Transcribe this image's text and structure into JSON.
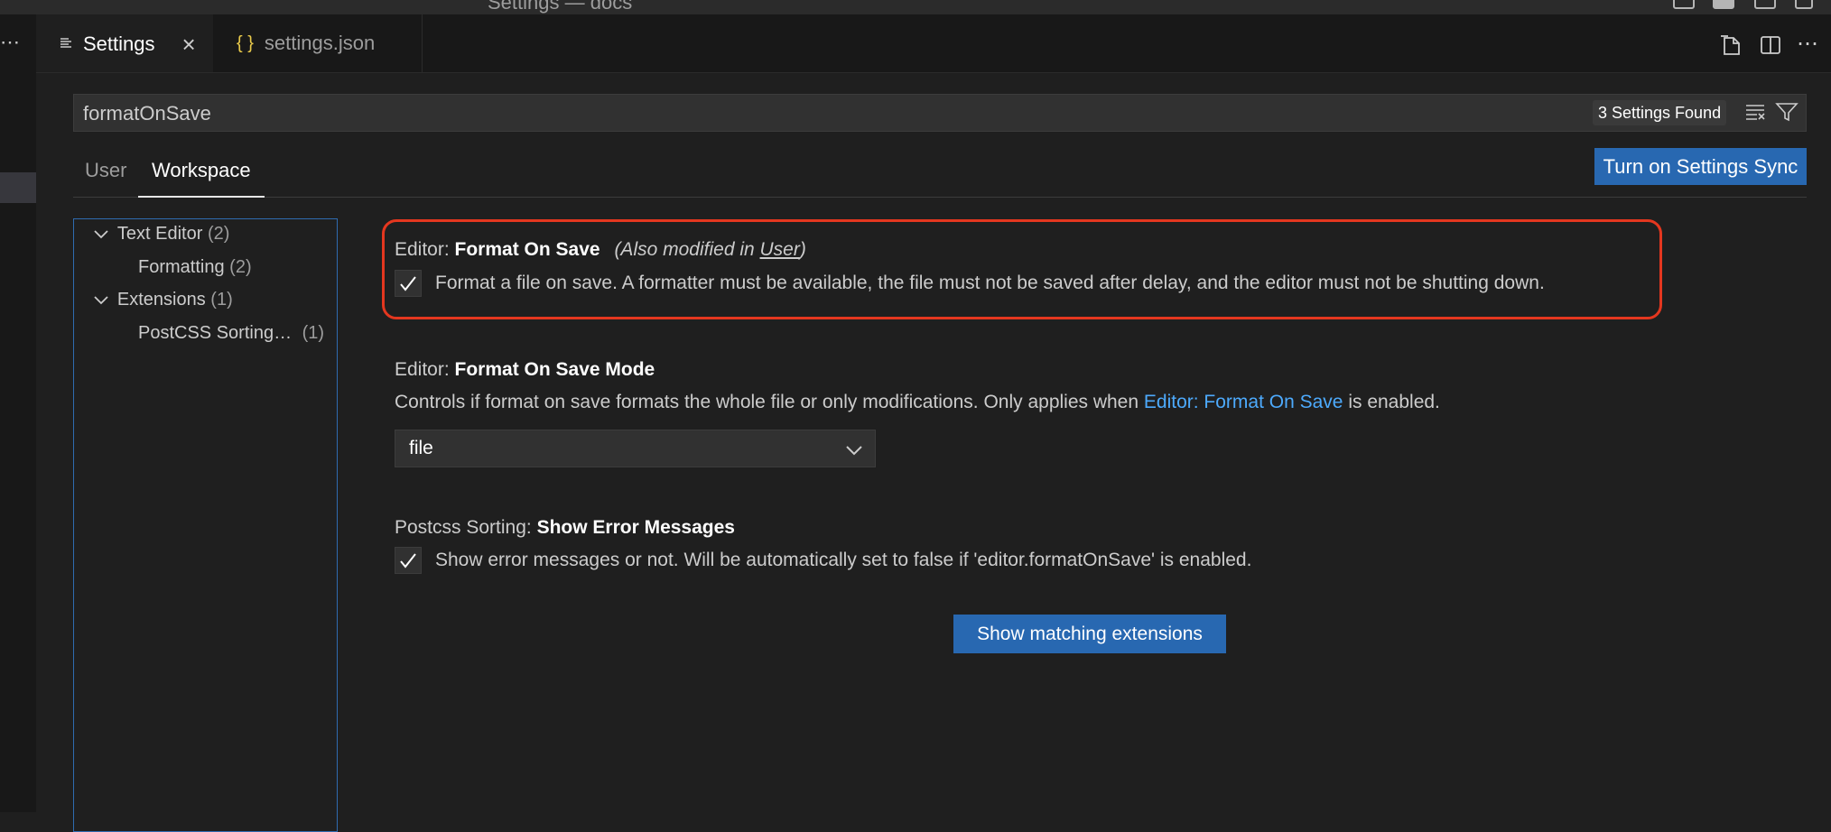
{
  "window": {
    "title": "Settings — docs"
  },
  "tabs": [
    {
      "label": "Settings",
      "icon": "settings-lines-icon"
    },
    {
      "label": "settings.json",
      "icon": "braces-icon",
      "icon_text": "{ }"
    }
  ],
  "search": {
    "value": "formatOnSave",
    "placeholder": "Search settings",
    "results": "3 Settings Found"
  },
  "scope_tabs": {
    "user": "User",
    "workspace": "Workspace",
    "active": "Workspace"
  },
  "sync_button": "Turn on Settings Sync",
  "toc": [
    {
      "label": "Text Editor",
      "count": "(2)"
    },
    {
      "label": "Formatting",
      "count": "(2)"
    },
    {
      "label": "Extensions",
      "count": "(1)"
    },
    {
      "label": "PostCSS Sorting…",
      "count": "(1)"
    }
  ],
  "settings": {
    "format_on_save": {
      "category": "Editor: ",
      "name": "Format On Save",
      "modified_prefix": "(Also modified in ",
      "modified_link": "User",
      "modified_suffix": ")",
      "checked": true,
      "description": "Format a file on save. A formatter must be available, the file must not be saved after delay, and the editor must not be shutting down."
    },
    "format_on_save_mode": {
      "category": "Editor: ",
      "name": "Format On Save Mode",
      "description_before": "Controls if format on save formats the whole file or only modifications. Only applies when ",
      "description_link": "Editor: Format On Save",
      "description_after": " is enabled.",
      "value": "file"
    },
    "show_error_messages": {
      "category": "Postcss Sorting: ",
      "name": "Show Error Messages",
      "checked": true,
      "description": "Show error messages or not. Will be automatically set to false if 'editor.formatOnSave' is enabled."
    }
  },
  "extensions_button": "Show matching extensions",
  "colors": {
    "accent": "#2868b1",
    "highlight": "#e4371f",
    "link": "#4daafc",
    "background": "#1f1f1f"
  }
}
